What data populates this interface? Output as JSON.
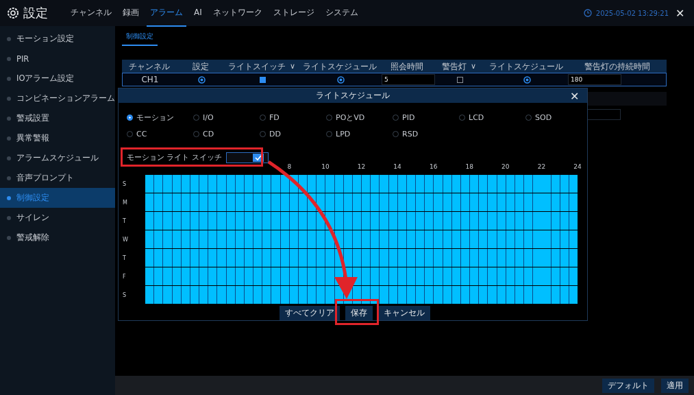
{
  "header": {
    "title": "設定",
    "tabs": [
      {
        "label": "チャンネル",
        "selected": false
      },
      {
        "label": "録画",
        "selected": false
      },
      {
        "label": "アラーム",
        "selected": true
      },
      {
        "label": "AI",
        "selected": false
      },
      {
        "label": "ネットワーク",
        "selected": false
      },
      {
        "label": "ストレージ",
        "selected": false
      },
      {
        "label": "システム",
        "selected": false
      }
    ],
    "datetime": "2025-05-02 13:29:21",
    "close": "✕"
  },
  "sidebar": {
    "items": [
      {
        "label": "モーション設定",
        "selected": false
      },
      {
        "label": "PIR",
        "selected": false
      },
      {
        "label": "IOアラーム設定",
        "selected": false
      },
      {
        "label": "コンビネーションアラーム",
        "selected": false
      },
      {
        "label": "警戒設置",
        "selected": false
      },
      {
        "label": "異常警報",
        "selected": false
      },
      {
        "label": "アラームスケジュール",
        "selected": false
      },
      {
        "label": "音声プロンプト",
        "selected": false
      },
      {
        "label": "制御設定",
        "selected": true
      },
      {
        "label": "サイレン",
        "selected": false
      },
      {
        "label": "警戒解除",
        "selected": false
      }
    ]
  },
  "subtabs": [
    {
      "label": "制御設定",
      "selected": true
    }
  ],
  "table": {
    "columns": [
      {
        "label": "チャンネル"
      },
      {
        "label": "設定"
      },
      {
        "label": "ライトスイッチ",
        "caret": "∨"
      },
      {
        "label": "ライトスケジュール"
      },
      {
        "label": "照会時間"
      },
      {
        "label": "警告灯",
        "caret": "∨"
      },
      {
        "label": "ライトスケジュール"
      },
      {
        "label": "警告灯の持続時間"
      }
    ],
    "rows": [
      {
        "kind": "full",
        "channel": "CH1",
        "light_switch": true,
        "light_duration": "5",
        "warning_light": false,
        "warning_duration": "180"
      },
      {
        "kind": "partial"
      },
      {
        "kind": "partial_field"
      }
    ]
  },
  "dialog": {
    "title": "ライトスケジュール",
    "close": "✕",
    "options": [
      {
        "label": "モーション",
        "selected": true
      },
      {
        "label": "I/O",
        "selected": false
      },
      {
        "label": "FD",
        "selected": false
      },
      {
        "label": "POとVD",
        "selected": false
      },
      {
        "label": "PID",
        "selected": false
      },
      {
        "label": "LCD",
        "selected": false
      },
      {
        "label": "SOD",
        "selected": false
      },
      {
        "label": "CC",
        "selected": false
      },
      {
        "label": "CD",
        "selected": false
      },
      {
        "label": "DD",
        "selected": false
      },
      {
        "label": "LPD",
        "selected": false
      },
      {
        "label": "RSD",
        "selected": false
      }
    ],
    "switch": {
      "label": "モーション ライト スイッチ",
      "on": true
    },
    "hour_labels": [
      "8",
      "10",
      "12",
      "14",
      "16",
      "18",
      "20",
      "22",
      "24"
    ],
    "days": [
      {
        "label": "S",
        "all_selected": true
      },
      {
        "label": "M",
        "all_selected": true
      },
      {
        "label": "T",
        "all_selected": true
      },
      {
        "label": "W",
        "all_selected": true
      },
      {
        "label": "T",
        "all_selected": true
      },
      {
        "label": "F",
        "all_selected": true
      },
      {
        "label": "S",
        "all_selected": true
      }
    ],
    "buttons": [
      "すべてクリア",
      "保存",
      "キャンセル"
    ]
  },
  "footer": {
    "buttons": [
      "デフォルト",
      "適用"
    ]
  }
}
